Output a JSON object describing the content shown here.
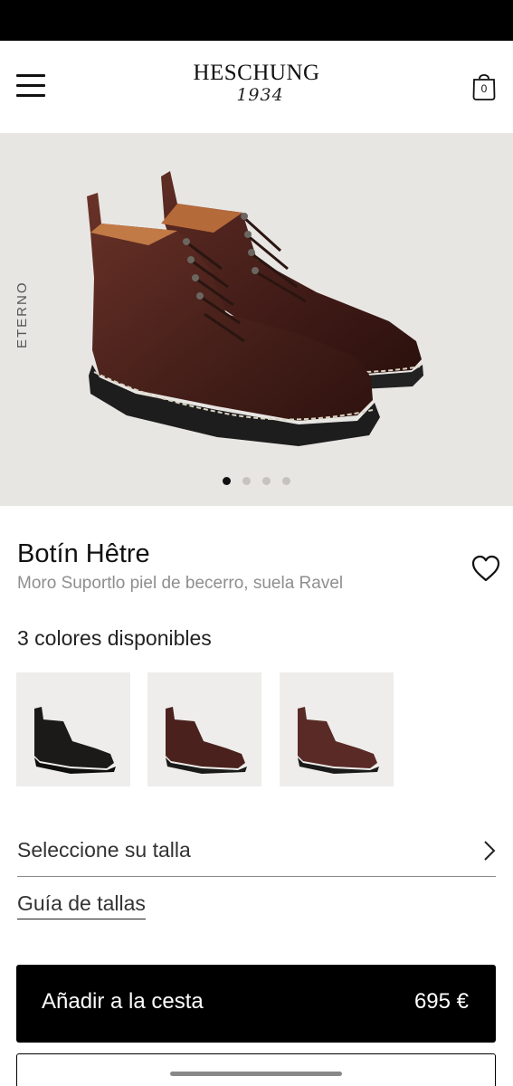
{
  "header": {
    "brand": "HESCHUNG",
    "brand_year": "1934",
    "cart_count": "0"
  },
  "gallery": {
    "collection_label": "ETERNO",
    "slide_count": 4,
    "active_slide": 1
  },
  "product": {
    "name": "Botín Hêtre",
    "description": "Moro Suportlo piel de becerro, suela Ravel",
    "colors_label": "3 colores disponibles",
    "swatches": [
      {
        "color_name": "black",
        "hex": "#1b1a19"
      },
      {
        "color_name": "moro",
        "hex": "#4a211c"
      },
      {
        "color_name": "burgundy",
        "hex": "#5a2a26"
      }
    ]
  },
  "size": {
    "select_label": "Seleccione su talla",
    "guide_label": "Guía de tallas"
  },
  "cta": {
    "add_label": "Añadir a la cesta",
    "price": "695 €"
  },
  "colors": {
    "accent": "#000000",
    "gallery_bg": "#e8e6e3",
    "muted_text": "#8e8e8e"
  }
}
